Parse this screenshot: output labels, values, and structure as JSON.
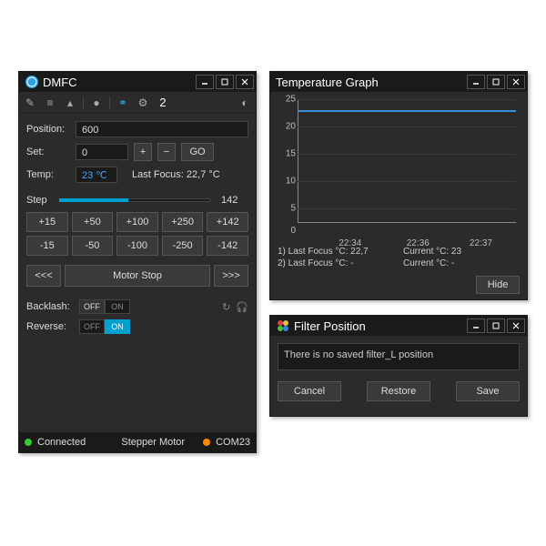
{
  "dmfc": {
    "title": "DMFC",
    "toolbar_count": "2",
    "position_label": "Position:",
    "position_value": "600",
    "set_label": "Set:",
    "set_value": "0",
    "go_label": "GO",
    "temp_label": "Temp:",
    "temp_value": "23 ℃",
    "last_focus": "Last Focus: 22,7 °C",
    "step_label": "Step",
    "step_value": "142",
    "step_slider_percent": 46,
    "steps_plus": [
      "+15",
      "+50",
      "+100",
      "+250",
      "+142"
    ],
    "steps_minus": [
      "-15",
      "-50",
      "-100",
      "-250",
      "-142"
    ],
    "motor_left": "<<<",
    "motor_stop": "Motor Stop",
    "motor_right": ">>>",
    "backlash_label": "Backlash:",
    "reverse_label": "Reverse:",
    "off": "OFF",
    "on": "ON",
    "status_connected": "Connected",
    "status_motor": "Stepper Motor",
    "status_port": "COM23"
  },
  "temp": {
    "title": "Temperature Graph",
    "info1": "1) Last Focus °C:   22,7",
    "info2": "2) Last Focus °C:   -",
    "cur1": "Current  °C:   23",
    "cur2": "Current  °C:   -",
    "hide": "Hide"
  },
  "filter": {
    "title": "Filter Position",
    "message": "There is no saved filter_L position",
    "cancel": "Cancel",
    "restore": "Restore",
    "save": "Save"
  },
  "chart_data": {
    "type": "line",
    "title": "Temperature Graph",
    "xlabel": "",
    "ylabel": "",
    "ylim": [
      0,
      25
    ],
    "yticks": [
      0,
      5,
      10,
      15,
      20,
      25
    ],
    "xticks": [
      "22:34",
      "22:36",
      "22:37"
    ],
    "series": [
      {
        "name": "temp",
        "x": [
          "22:33",
          "22:34",
          "22:35",
          "22:36",
          "22:37",
          "22:38"
        ],
        "values": [
          23,
          23,
          22.8,
          23,
          23,
          23.2
        ]
      }
    ]
  }
}
